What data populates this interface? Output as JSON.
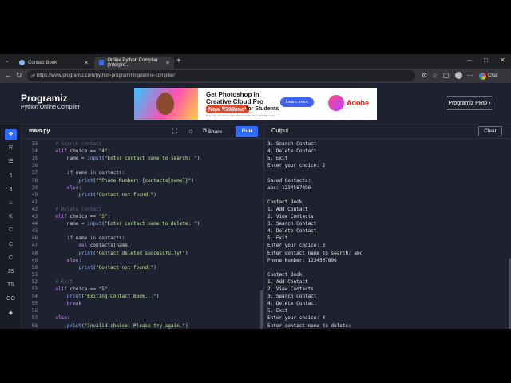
{
  "browser": {
    "tabs": [
      {
        "title": "Contact Book",
        "active": false
      },
      {
        "title": "Online Python Compiler (Interpre...",
        "active": true
      }
    ],
    "url": "https://www.programiz.com/python-programming/online-compiler/",
    "chat_label": "Chat"
  },
  "site": {
    "logo": "Programiz",
    "subtitle": "Python Online Compiler",
    "pro_button": "Programiz PRO ›",
    "ad": {
      "line1": "Get Photoshop in",
      "line2": "Creative Cloud Pro",
      "price_badge": "Now ₹399/mo*",
      "price_suffix": "for Students",
      "fine_print": "First year only. Annual plan, billed monthly. New subscribers only.",
      "cta": "Learn more",
      "brand": "Adobe"
    }
  },
  "editor": {
    "filename": "main.py",
    "share_label": "Share",
    "run_label": "Run",
    "lines": [
      {
        "n": "33",
        "indent": "    ",
        "parts": [
          [
            "cm",
            "# Search Contact"
          ]
        ]
      },
      {
        "n": "34",
        "indent": "    ",
        "parts": [
          [
            "kw",
            "elif"
          ],
          [
            "code",
            " choice == "
          ],
          [
            "str",
            "\"4\""
          ],
          [
            "code",
            ":"
          ]
        ]
      },
      {
        "n": "35",
        "indent": "        ",
        "parts": [
          [
            "code",
            "name = "
          ],
          [
            "fn",
            "input"
          ],
          [
            "code",
            "("
          ],
          [
            "str",
            "\"Enter contact name to search: \""
          ],
          [
            "code",
            ")"
          ]
        ]
      },
      {
        "n": "36",
        "indent": "",
        "parts": []
      },
      {
        "n": "37",
        "indent": "        ",
        "parts": [
          [
            "kw",
            "if"
          ],
          [
            "code",
            " name "
          ],
          [
            "kw",
            "in"
          ],
          [
            "code",
            " contacts:"
          ]
        ]
      },
      {
        "n": "38",
        "indent": "            ",
        "parts": [
          [
            "fn",
            "print"
          ],
          [
            "code",
            "("
          ],
          [
            "str",
            "f\"Phone Number: {contacts[name]}\""
          ],
          [
            "code",
            ")"
          ]
        ]
      },
      {
        "n": "39",
        "indent": "        ",
        "parts": [
          [
            "kw",
            "else"
          ],
          [
            "code",
            ":"
          ]
        ]
      },
      {
        "n": "40",
        "indent": "            ",
        "parts": [
          [
            "fn",
            "print"
          ],
          [
            "code",
            "("
          ],
          [
            "str",
            "\"Contact not found.\""
          ],
          [
            "code",
            ")"
          ]
        ]
      },
      {
        "n": "41",
        "indent": "",
        "parts": []
      },
      {
        "n": "42",
        "indent": "    ",
        "parts": [
          [
            "cm",
            "# Delete Contact"
          ]
        ]
      },
      {
        "n": "43",
        "indent": "    ",
        "parts": [
          [
            "kw",
            "elif"
          ],
          [
            "code",
            " choice == "
          ],
          [
            "str",
            "\"5\""
          ],
          [
            "code",
            ":"
          ]
        ]
      },
      {
        "n": "44",
        "indent": "        ",
        "parts": [
          [
            "code",
            "name = "
          ],
          [
            "fn",
            "input"
          ],
          [
            "code",
            "("
          ],
          [
            "str",
            "\"Enter contact name to delete: \""
          ],
          [
            "code",
            ")"
          ]
        ]
      },
      {
        "n": "45",
        "indent": "",
        "parts": []
      },
      {
        "n": "46",
        "indent": "        ",
        "parts": [
          [
            "kw",
            "if"
          ],
          [
            "code",
            " name "
          ],
          [
            "kw",
            "in"
          ],
          [
            "code",
            " contacts:"
          ]
        ]
      },
      {
        "n": "47",
        "indent": "            ",
        "parts": [
          [
            "kw",
            "del"
          ],
          [
            "code",
            " contacts[name]"
          ]
        ]
      },
      {
        "n": "48",
        "indent": "            ",
        "parts": [
          [
            "fn",
            "print"
          ],
          [
            "code",
            "("
          ],
          [
            "str",
            "\"Contact deleted successfully!\""
          ],
          [
            "code",
            ")"
          ]
        ]
      },
      {
        "n": "49",
        "indent": "        ",
        "parts": [
          [
            "kw",
            "else"
          ],
          [
            "code",
            ":"
          ]
        ]
      },
      {
        "n": "50",
        "indent": "            ",
        "parts": [
          [
            "fn",
            "print"
          ],
          [
            "code",
            "("
          ],
          [
            "str",
            "\"Contact not found.\""
          ],
          [
            "code",
            ")"
          ]
        ]
      },
      {
        "n": "51",
        "indent": "",
        "parts": []
      },
      {
        "n": "52",
        "indent": "    ",
        "parts": [
          [
            "cm",
            "# Exit"
          ]
        ]
      },
      {
        "n": "53",
        "indent": "    ",
        "parts": [
          [
            "kw",
            "elif"
          ],
          [
            "code",
            " choice == "
          ],
          [
            "str",
            "\"5\""
          ],
          [
            "code",
            ":"
          ]
        ]
      },
      {
        "n": "54",
        "indent": "        ",
        "parts": [
          [
            "fn",
            "print"
          ],
          [
            "code",
            "("
          ],
          [
            "str",
            "\"Exiting Contact Book...\""
          ],
          [
            "code",
            ")"
          ]
        ]
      },
      {
        "n": "55",
        "indent": "        ",
        "parts": [
          [
            "kw",
            "break"
          ]
        ]
      },
      {
        "n": "56",
        "indent": "",
        "parts": []
      },
      {
        "n": "57",
        "indent": "    ",
        "parts": [
          [
            "kw",
            "else"
          ],
          [
            "code",
            ":"
          ]
        ]
      },
      {
        "n": "58",
        "indent": "        ",
        "parts": [
          [
            "fn",
            "print"
          ],
          [
            "code",
            "("
          ],
          [
            "str",
            "\"Invalid choice! Please try again.\""
          ],
          [
            "code",
            ")"
          ]
        ]
      }
    ]
  },
  "output": {
    "title": "Output",
    "clear_label": "Clear",
    "lines": [
      "3. Search Contact",
      "4. Delete Contact",
      "5. Exit",
      "Enter your choice: 2",
      "",
      "Saved Contacts:",
      "abc: 1234567896",
      "",
      "Contact Book",
      "1. Add Contact",
      "2. View Contacts",
      "3. Search Contact",
      "4. Delete Contact",
      "5. Exit",
      "Enter your choice: 3",
      "Enter contact name to search: abc",
      "Phone Number: 1234567896",
      "",
      "Contact Book",
      "1. Add Contact",
      "2. View Contacts",
      "3. Search Contact",
      "4. Delete Contact",
      "5. Exit",
      "Enter your choice: 4",
      "Enter contact name to delete: "
    ]
  },
  "rail": {
    "languages": [
      {
        "icon": "python-icon",
        "glyph": "❖",
        "active": true
      },
      {
        "icon": "r-icon",
        "glyph": "R"
      },
      {
        "icon": "sql-icon",
        "glyph": "☰"
      },
      {
        "icon": "html-icon",
        "glyph": "5"
      },
      {
        "icon": "css-icon",
        "glyph": "3"
      },
      {
        "icon": "java-icon",
        "glyph": "♨"
      },
      {
        "icon": "kotlin-icon",
        "glyph": "K"
      },
      {
        "icon": "c-icon",
        "glyph": "C"
      },
      {
        "icon": "cpp-icon",
        "glyph": "C"
      },
      {
        "icon": "csharp-icon",
        "glyph": "C"
      },
      {
        "icon": "js-icon",
        "glyph": "JS"
      },
      {
        "icon": "ts-icon",
        "glyph": "TS"
      },
      {
        "icon": "go-icon",
        "glyph": "GO"
      },
      {
        "icon": "swift-icon",
        "glyph": "◆"
      }
    ]
  }
}
